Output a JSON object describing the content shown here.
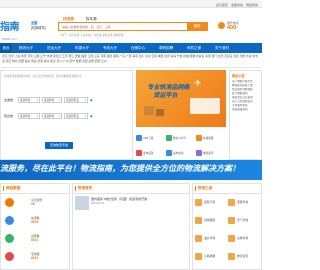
{
  "topbar": {
    "links": [
      "设为首页",
      "收藏本站",
      "网站导航"
    ]
  },
  "header": {
    "logo": "指南",
    "logo_sub": "56888.com",
    "city": {
      "name": "全国",
      "switch": "[切换城市]"
    },
    "search_tabs": [
      "找货源",
      "找车源"
    ],
    "search_placeholder": "请输入出发地/目的地，如：北京，上海",
    "search_button": "搜索",
    "hotwords": "热门：北京专线 上海专线 广州专线 深圳专线 成都专线",
    "hotline_label": "服务热线",
    "hotline_number": "400-"
  },
  "nav": {
    "items": [
      "首页",
      "物流大厅",
      "货运大厅",
      "车源大厅",
      "专线大厅",
      "仓储中心",
      "求职招聘",
      "司机之家",
      "关于我们"
    ]
  },
  "citybar": "北京 天津 上海 重庆 河北 山西 辽宁 吉林 黑龙江 江苏 浙江 安徽 福建 江西 山东 河南 湖北 湖南 广东 广西 海南 四川 贵州 云南 陕西 甘肃 青海 宁夏 新疆 西藏 内蒙古 香港 澳门 台湾 石家庄 太原 沈阳 长春 哈尔滨 南京 杭州 合肥 福州 南昌 济南 郑州 武汉 长沙 广州 南宁 成都 贵阳 昆明 西安 兰州",
  "route_search": {
    "tip": "请选择出发地和目的地，然后点击查询按钮，即可查看物流专线信息",
    "from_label": "出发地",
    "to_label": "到达地",
    "province": "请选择省",
    "city": "请选择市",
    "district": "请选择区县",
    "button": "查询物流专线"
  },
  "banner": {
    "title1": "专业快消品网络",
    "title2": "货运平台"
  },
  "app_links": [
    "APP下载",
    "微信公众号",
    "在线客服",
    "发布货源",
    "发布车源",
    "物流资讯"
  ],
  "side_card": {
    "title": "网站公告",
    "items": [
      "关于网站升级公告",
      "物流指南新版上线",
      "会员服务调整通知",
      "春节放假通知",
      "诚信会员认证说明",
      "关于打击虚假信息",
      "平台服务协议",
      "隐私政策说明"
    ]
  },
  "slogan": "流服务，尽在此平台！物流指南，为您提供全方位的物流解决方案！",
  "stats": {
    "title": "网站数据",
    "items": [
      {
        "label": "今日新增",
        "value": "90",
        "color": "#f07a00"
      },
      {
        "label": "车源数",
        "value": "5634",
        "color": "#3a8be0"
      },
      {
        "label": "货源数",
        "value": "8011",
        "color": "#35b56a"
      },
      {
        "label": "专线数",
        "value": "6011",
        "color": "#e34a4a"
      }
    ]
  },
  "news": {
    "title": "物流资讯",
    "items": [
      {
        "title": "国内首条“中欧”班列（东盟）货运专线开通...",
        "desc": "2023-06-12"
      }
    ]
  },
  "tools": {
    "title": "物流工具",
    "items": [
      "运费计算",
      "里程查询",
      "货物跟踪",
      "天气查询",
      "油价查询",
      "违章查询",
      "公路地图",
      "物流黄页"
    ]
  }
}
